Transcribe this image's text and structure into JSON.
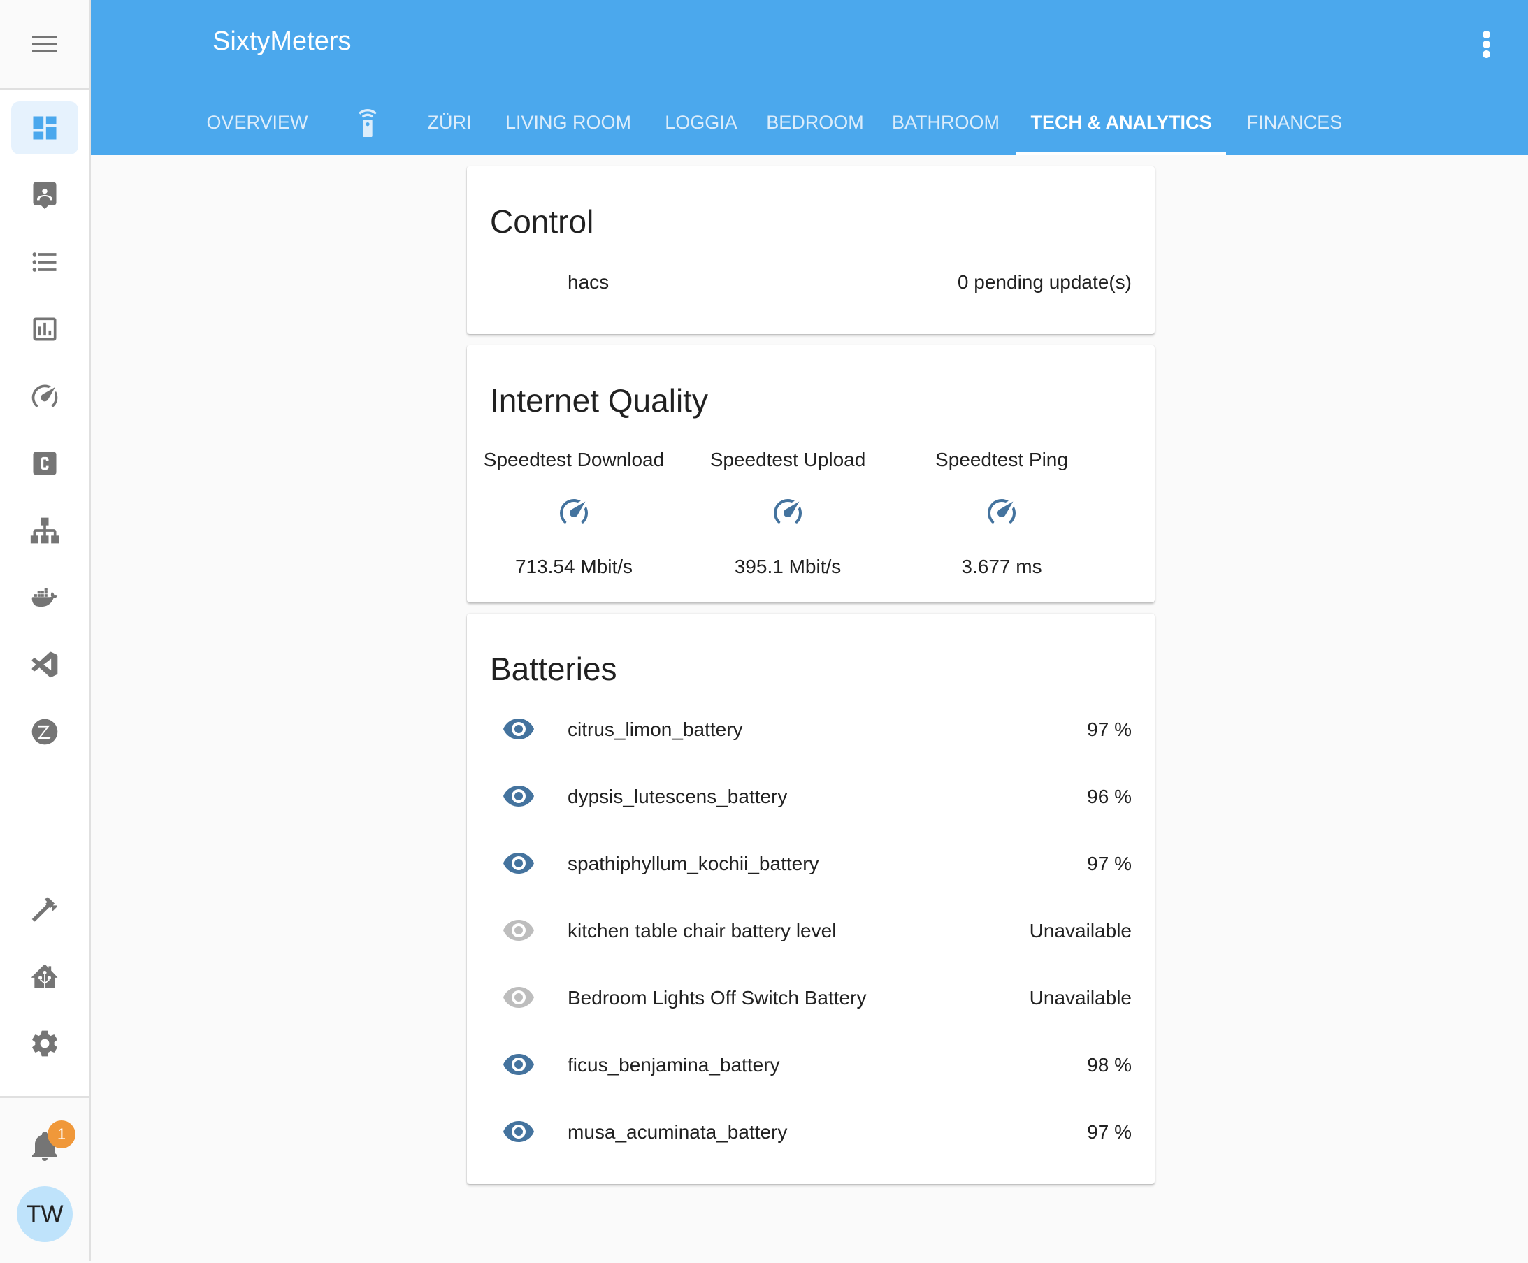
{
  "app": {
    "title": "SixtyMeters"
  },
  "header": {
    "menu_icon": "more-vertical-icon",
    "tabs": [
      {
        "label": "OVERVIEW",
        "active": false
      },
      {
        "label": "",
        "icon": "remote-icon",
        "active": false
      },
      {
        "label": "ZÜRI",
        "active": false
      },
      {
        "label": "LIVING ROOM",
        "active": false
      },
      {
        "label": "LOGGIA",
        "active": false
      },
      {
        "label": "BEDROOM",
        "active": false
      },
      {
        "label": "BATHROOM",
        "active": false
      },
      {
        "label": "TECH & ANALYTICS",
        "active": true
      },
      {
        "label": "FINANCES",
        "active": false
      }
    ]
  },
  "sidebar": {
    "items": [
      {
        "icon": "dashboard-icon",
        "active": true
      },
      {
        "icon": "account-location-icon",
        "active": false
      },
      {
        "icon": "format-list-icon",
        "active": false
      },
      {
        "icon": "chart-box-icon",
        "active": false
      },
      {
        "icon": "speedometer-icon",
        "active": false
      },
      {
        "icon": "c-box-icon",
        "active": false
      },
      {
        "icon": "network-sitemap-icon",
        "active": false
      },
      {
        "icon": "docker-icon",
        "active": false
      },
      {
        "icon": "vscode-icon",
        "active": false
      },
      {
        "icon": "zwave-icon",
        "active": false
      },
      {
        "icon": "hammer-icon",
        "active": false
      },
      {
        "icon": "home-assistant-icon",
        "active": false
      },
      {
        "icon": "settings-icon",
        "active": false
      }
    ],
    "notifications": {
      "icon": "bell-icon",
      "count": "1"
    },
    "user": {
      "initials": "TW"
    }
  },
  "cards": {
    "control": {
      "title": "Control",
      "rows": [
        {
          "name": "hacs",
          "value": "0 pending update(s)"
        }
      ]
    },
    "internet": {
      "title": "Internet Quality",
      "items": [
        {
          "name": "Speedtest Download",
          "state": "713.54 Mbit/s",
          "icon": "speedometer-icon"
        },
        {
          "name": "Speedtest Upload",
          "state": "395.1 Mbit/s",
          "icon": "speedometer-icon"
        },
        {
          "name": "Speedtest Ping",
          "state": "3.677 ms",
          "icon": "speedometer-icon"
        }
      ]
    },
    "batteries": {
      "title": "Batteries",
      "rows": [
        {
          "name": "citrus_limon_battery",
          "value": "97 %",
          "available": true
        },
        {
          "name": "dypsis_lutescens_battery",
          "value": "96 %",
          "available": true
        },
        {
          "name": "spathiphyllum_kochii_battery",
          "value": "97 %",
          "available": true
        },
        {
          "name": "kitchen table chair battery level",
          "value": "Unavailable",
          "available": false
        },
        {
          "name": "Bedroom Lights Off Switch Battery",
          "value": "Unavailable",
          "available": false
        },
        {
          "name": "ficus_benjamina_battery",
          "value": "98 %",
          "available": true
        },
        {
          "name": "musa_acuminata_battery",
          "value": "97 %",
          "available": true
        }
      ]
    }
  },
  "colors": {
    "header": "#4ba8ed",
    "accent": "#4ba8ed",
    "icon_state": "#44739e",
    "icon_unavailable": "#bdbdbd",
    "badge": "#f0983a",
    "avatar": "#bfe3fb"
  }
}
